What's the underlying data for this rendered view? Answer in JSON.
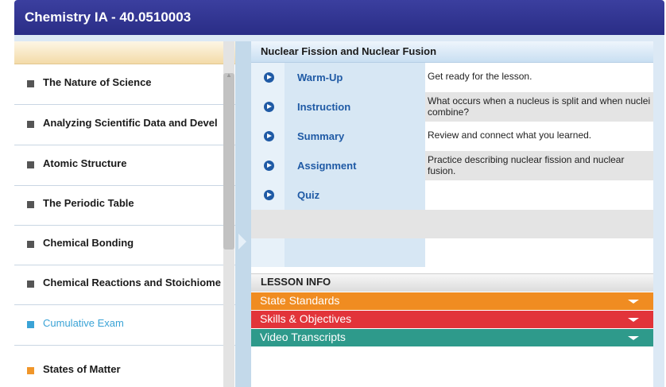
{
  "window": {
    "title": "Chemistry IA - 40.0510003"
  },
  "units": [
    {
      "label": "The Nature of Science",
      "state": "normal"
    },
    {
      "label": "Analyzing Scientific Data and Devel",
      "state": "normal"
    },
    {
      "label": "Atomic Structure",
      "state": "normal"
    },
    {
      "label": "The Periodic Table",
      "state": "normal"
    },
    {
      "label": "Chemical Bonding",
      "state": "normal"
    },
    {
      "label": "Chemical Reactions and Stoichiome",
      "state": "normal"
    },
    {
      "label": "Cumulative Exam",
      "state": "active"
    },
    {
      "label": "States of Matter",
      "state": "orange"
    }
  ],
  "lesson": {
    "title": "Nuclear Fission and Nuclear Fusion",
    "steps": [
      {
        "name": "Warm-Up",
        "desc": "Get ready for the lesson."
      },
      {
        "name": "Instruction",
        "desc": "What occurs when a nucleus is split and when nuclei combine?"
      },
      {
        "name": "Summary",
        "desc": "Review and connect what you learned."
      },
      {
        "name": "Assignment",
        "desc": "Practice describing nuclear fission and nuclear fusion."
      },
      {
        "name": "Quiz",
        "desc": ""
      }
    ]
  },
  "lesson_info": {
    "heading": "LESSON INFO",
    "bars": [
      {
        "label": "State Standards",
        "color": "#f08c21"
      },
      {
        "label": "Skills & Objectives",
        "color": "#e2343a"
      },
      {
        "label": "Video Transcripts",
        "color": "#2e9a8b"
      }
    ]
  },
  "icons": {
    "play": "play-circle-icon",
    "expand": "chevron-down-icon",
    "collapse": "chevron-right-icon"
  },
  "colors": {
    "titlebar": "#2f3290",
    "accent_blue": "#1f5aa5",
    "active_unit": "#3aa3d6"
  }
}
